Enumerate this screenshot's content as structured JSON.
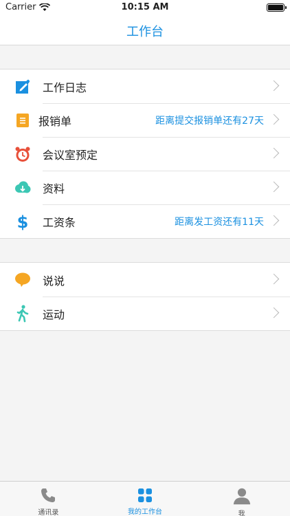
{
  "status_bar": {
    "carrier": "Carrier",
    "time": "10:15 AM"
  },
  "nav": {
    "title": "工作台"
  },
  "group1": [
    {
      "icon": "pencil-note-icon",
      "label": "工作日志",
      "hint": ""
    },
    {
      "icon": "receipt-icon",
      "label": "报销单",
      "hint": "距离提交报销单还有27天"
    },
    {
      "icon": "alarm-clock-icon",
      "label": "会议室预定",
      "hint": ""
    },
    {
      "icon": "cloud-download-icon",
      "label": "资料",
      "hint": ""
    },
    {
      "icon": "dollar-icon",
      "label": "工资条",
      "hint": "距离发工资还有11天"
    }
  ],
  "group2": [
    {
      "icon": "speech-bubble-icon",
      "label": "说说",
      "hint": ""
    },
    {
      "icon": "walking-person-icon",
      "label": "运动",
      "hint": ""
    }
  ],
  "tabs": [
    {
      "icon": "phone-icon",
      "label": "通讯录",
      "active": false
    },
    {
      "icon": "grid-icon",
      "label": "我的工作台",
      "active": true
    },
    {
      "icon": "person-icon",
      "label": "我",
      "active": false
    }
  ],
  "colors": {
    "accent": "#1a90e0",
    "orange": "#f5a623",
    "red": "#e8503a",
    "teal": "#3cc7b4"
  }
}
